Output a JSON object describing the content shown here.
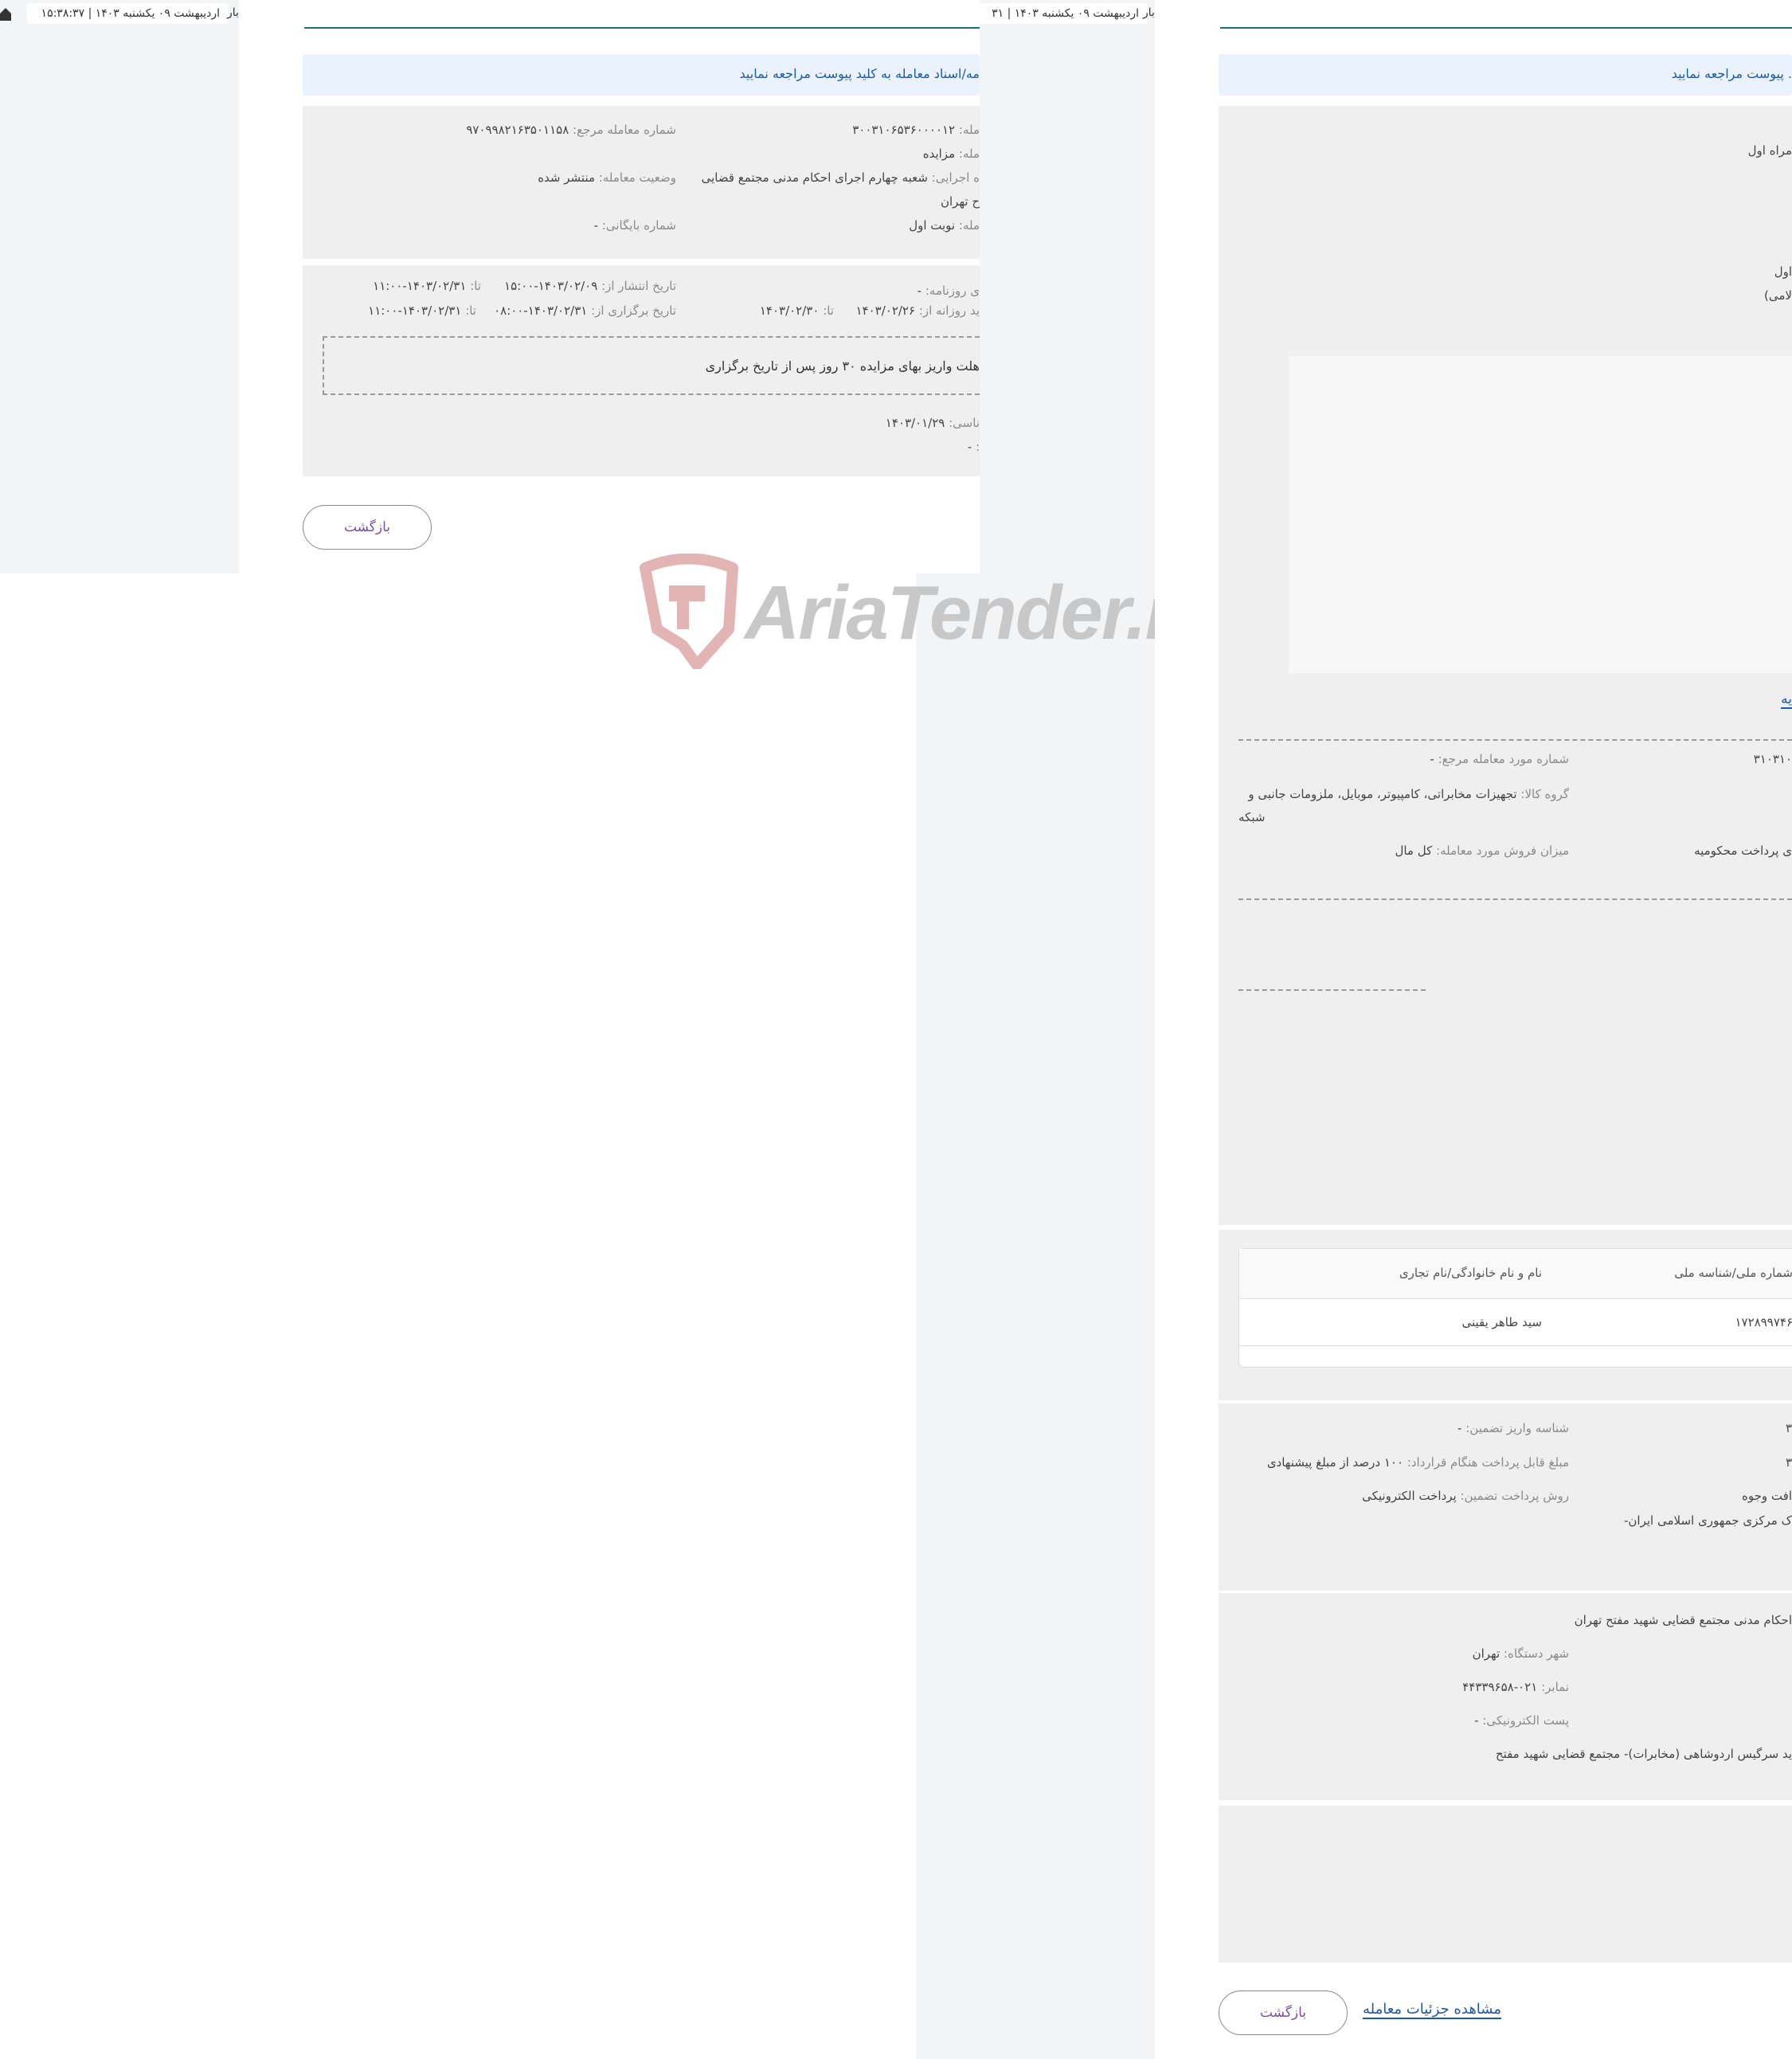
{
  "screen1": {
    "date_label": "اردیبهشت ۰۹ یکشنبه ۱۴۰۳",
    "time": "۱۵:۳۸:۳۷",
    "separator": "|",
    "tail": "بار"
  },
  "screen2": {
    "date_label": "اردیبهشت ۰۹ یکشنبه ۱۴۰۳",
    "day_num": "۳۱",
    "separator": "|",
    "tail": "بار",
    "info_text": "مه/اسناد معامله به کلید پیوست مراجعه نمایید",
    "fields": {
      "deal_no": {
        "label": "مله:",
        "value": "۳۰۰۳۱۰۶۵۳۶۰۰۰۰۱۲"
      },
      "ref_no": {
        "label": "شماره معامله مرجع:",
        "value": "۹۷۰۹۹۸۲۱۶۳۵۰۱۱۵۸"
      },
      "deal_type": {
        "label": "مله:",
        "value": "مزایده"
      },
      "deal_status": {
        "label": "وضعیت معامله:",
        "value": "منتشر شده"
      },
      "exec_unit": {
        "label": "ه اجرایی:",
        "value": "شعبه چهارم اجرای احکام مدنی مجتمع قضایی"
      },
      "exec_unit_cont": "ح تهران",
      "round": {
        "label": "مله:",
        "value": "نوبت اول"
      },
      "archive_no": {
        "label": "شماره بایگانی:",
        "value": "-"
      },
      "newspaper": {
        "label": "ی روزنامه:",
        "value": "-"
      },
      "publish_from": {
        "label": "تاریخ انتشار از:",
        "value": "۱۴۰۳/۰۲/۰۹-۱۵:۰۰"
      },
      "publish_to": {
        "label": "تا:",
        "value": "۱۴۰۳/۰۲/۳۱-۱۱:۰۰"
      },
      "daily_from": {
        "label": "ید روزانه از:",
        "value": "۱۴۰۳/۰۲/۲۶"
      },
      "daily_to": {
        "label": "تا:",
        "value": "۱۴۰۳/۰۲/۳۰"
      },
      "hold_from": {
        "label": "تاریخ برگزاری از:",
        "value": "۱۴۰۳/۰۲/۳۱-۰۸:۰۰"
      },
      "hold_to": {
        "label": "تا:",
        "value": "۱۴۰۳/۰۲/۳۱-۱۱:۰۰"
      },
      "notice": "هلت واریز بهای مزایده ۳۰ روز پس از تاریخ برگزاری",
      "expert_date": {
        "label": "ناسی:",
        "value": "۱۴۰۳/۰۱/۲۹"
      },
      "extra": {
        "label": ":",
        "value": "-"
      }
    },
    "back_button": "بازگشت"
  },
  "watermark": {
    "text": "AriaTender.neT",
    "colors": {
      "logo": "#e3b4b4",
      "text": "#c8c8c8"
    }
  },
  "screen3": {
    "info_text": ". پیوست مراجعه نمایید",
    "first_field": "مراه اول",
    "field_aval": "اول",
    "field_eslami": "لامی)",
    "link_frag": "یه",
    "ref_subject": {
      "label": "شماره مورد معامله مرجع:",
      "value": "-"
    },
    "ref_num_frag": "۳۱۰۳۱۰",
    "goods_group": {
      "label": "گروه کالا:",
      "value": "تجهیزات مخابراتی، کامپیوتر، موبایل، ملزومات جانبی و",
      "cont": "شبکه"
    },
    "sale_amount": {
      "label": "میزان فروش مورد معامله:",
      "value": "کل مال"
    },
    "pay_frag": "ی پرداخت محکومیه",
    "table": {
      "headers": [
        "شماره ملی/شناسه ملی",
        "نام و نام خانوادگی/نام تجاری"
      ],
      "rows": [
        [
          "۱۷۲۸۹۹۷۴۶",
          "سید طاهر یقینی"
        ]
      ]
    },
    "guarantee_id": {
      "label": "شناسه واریز تضمین:",
      "value": "-"
    },
    "contract_pay": {
      "label": "مبلغ قابل پرداخت هنگام قرارداد:",
      "value": "۱۰۰ درصد از مبلغ پیشنهادی"
    },
    "guarantee_method": {
      "label": "روش پرداخت تضمین:",
      "value": "پرداخت الکترونیکی"
    },
    "frag_3a": "۳",
    "frag_3b": "۳",
    "funds_frag": "افت وجوه",
    "bank_frag": "ک مرکزی جمهوری اسلامی ایران-",
    "org_name": "احکام مدنی مجتمع قضایی شهید مفتح تهران",
    "city": {
      "label": "شهر دستگاه:",
      "value": "تهران"
    },
    "fax": {
      "label": "نمابر:",
      "value": "۰۲۱-۴۴۳۳۹۶۵۸"
    },
    "email": {
      "label": "پست الکترونیکی:",
      "value": "-"
    },
    "address": "ید سرگیس اردوشاهی (مخابرات)- مجتمع قضایی شهید مفتح",
    "back_button": "بازگشت",
    "details_link": "مشاهده جزئیات معامله"
  }
}
